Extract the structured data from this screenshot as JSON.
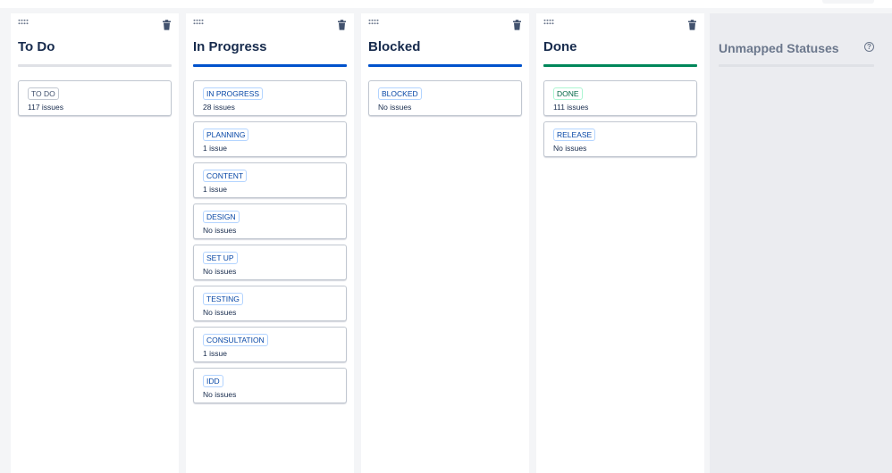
{
  "colors": {
    "todo_bar": "#dfe1e6",
    "in_progress_bar": "#0052cc",
    "blocked_bar": "#0052cc",
    "done_bar": "#00875a"
  },
  "columns": [
    {
      "title": "To Do",
      "cards": [
        {
          "status": "TO DO",
          "count": "117 issues"
        }
      ]
    },
    {
      "title": "In Progress",
      "cards": [
        {
          "status": "IN PROGRESS",
          "count": "28 issues"
        },
        {
          "status": "PLANNING",
          "count": "1 issue"
        },
        {
          "status": "CONTENT",
          "count": "1 issue"
        },
        {
          "status": "DESIGN",
          "count": "No issues"
        },
        {
          "status": "SET UP",
          "count": "No issues"
        },
        {
          "status": "TESTING",
          "count": "No issues"
        },
        {
          "status": "CONSULTATION",
          "count": "1 issue"
        },
        {
          "status": "IDD",
          "count": "No issues"
        }
      ]
    },
    {
      "title": "Blocked",
      "cards": [
        {
          "status": "BLOCKED",
          "count": "No issues"
        }
      ]
    },
    {
      "title": "Done",
      "cards": [
        {
          "status": "DONE",
          "count": "111 issues"
        },
        {
          "status": "RELEASE",
          "count": "No issues"
        }
      ]
    }
  ],
  "unmapped": {
    "title": "Unmapped Statuses",
    "help_icon": "?"
  }
}
